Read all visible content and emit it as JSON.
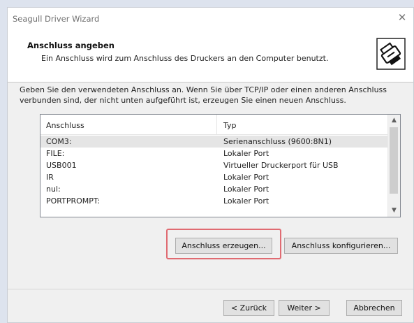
{
  "window": {
    "title": "Seagull Driver Wizard",
    "close_glyph": "✕"
  },
  "header": {
    "title": "Anschluss angeben",
    "subtitle": "Ein Anschluss wird zum Anschluss des Druckers an den Computer benutzt.",
    "icon": "printer-wizard-icon"
  },
  "description": "Geben Sie den verwendeten Anschluss an. Wenn Sie über TCP/IP oder einen anderen Anschluss verbunden sind, der nicht unten aufgeführt ist, erzeugen Sie einen neuen Anschluss.",
  "port_list": {
    "columns": [
      "Anschluss",
      "Typ"
    ],
    "rows": [
      {
        "port": "COM3:",
        "type": "Serienanschluss (9600:8N1)"
      },
      {
        "port": "FILE:",
        "type": "Lokaler Port"
      },
      {
        "port": "USB001",
        "type": "Virtueller Druckerport für USB"
      },
      {
        "port": "IR",
        "type": "Lokaler Port"
      },
      {
        "port": "nul:",
        "type": "Lokaler Port"
      },
      {
        "port": "PORTPROMPT:",
        "type": "Lokaler Port"
      }
    ],
    "selected_row": 0
  },
  "buttons": {
    "create_port": "Anschluss erzeugen...",
    "configure_port": "Anschluss konfigurieren...",
    "back": "< Zurück",
    "next": "Weiter >",
    "cancel": "Abbrechen"
  },
  "colors": {
    "highlight_border": "#e06b72",
    "selected_row": "#e5e5e5"
  }
}
